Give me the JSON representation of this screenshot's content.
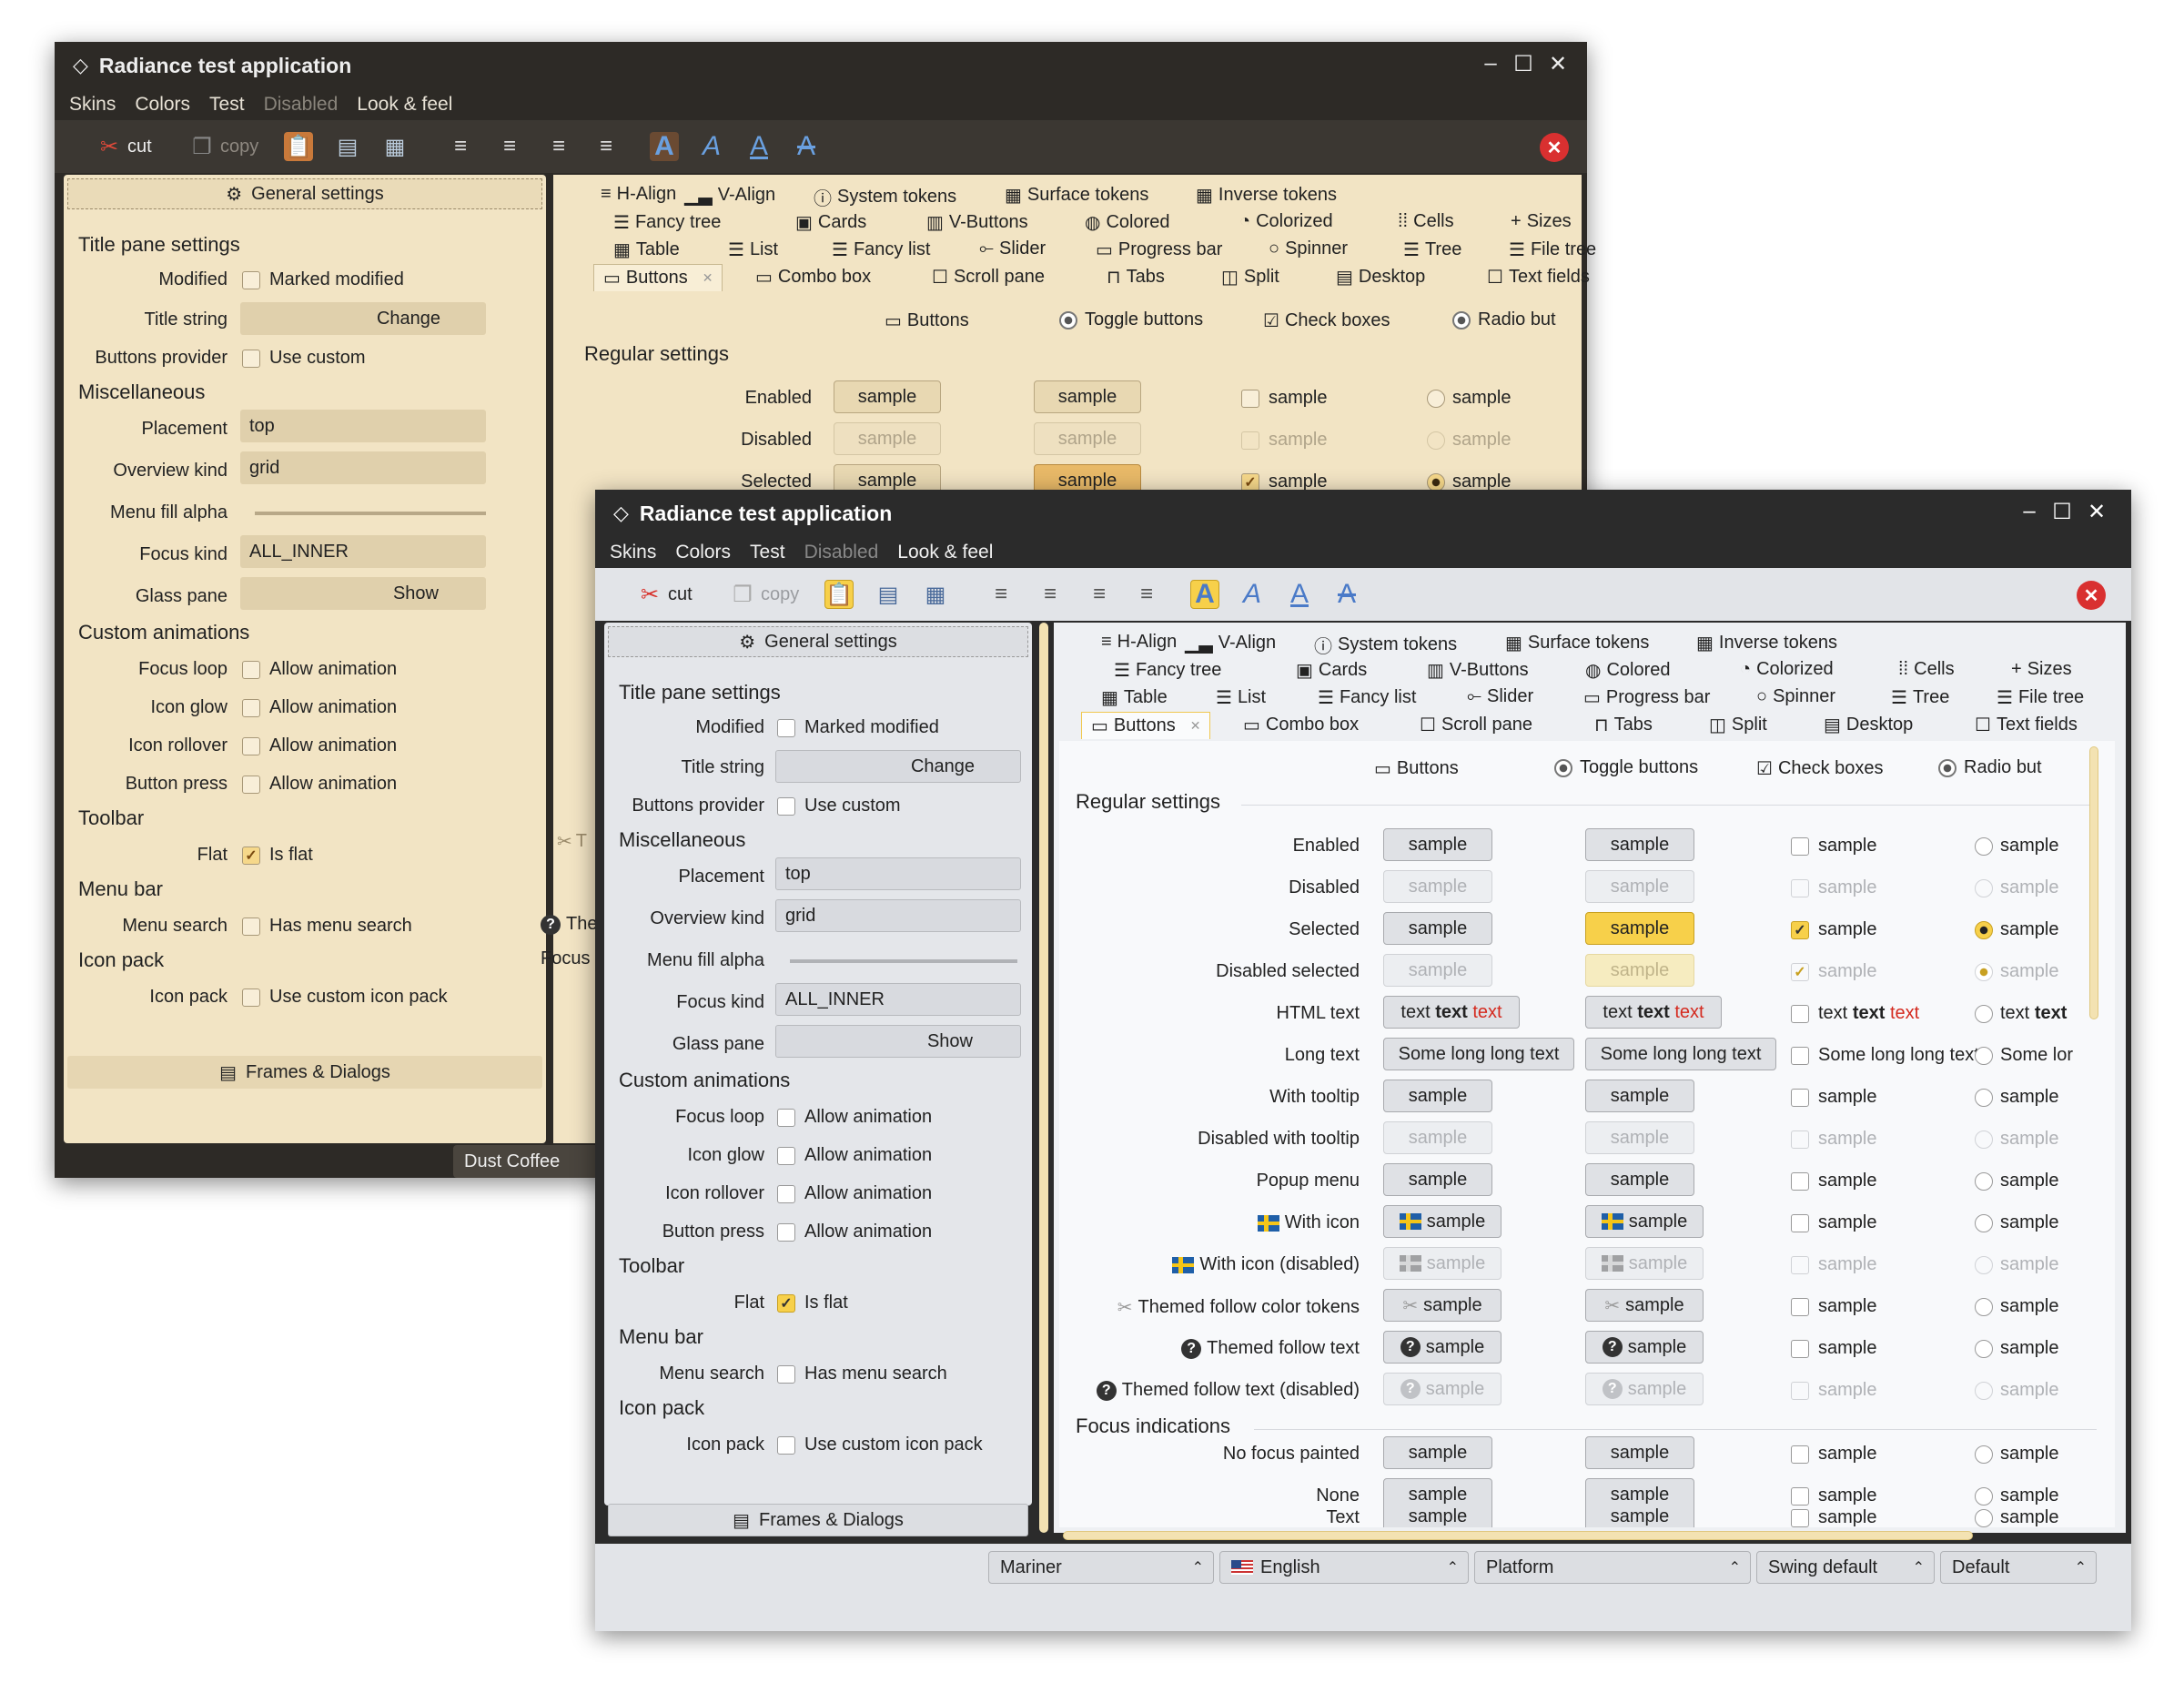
{
  "app": {
    "title": "Radiance test application"
  },
  "menu": [
    "Skins",
    "Colors",
    "Test",
    "Disabled",
    "Look & feel"
  ],
  "toolbar": {
    "cut": "cut",
    "copy": "copy"
  },
  "tabs_rows": [
    [
      "H-Align",
      "V-Align",
      "System tokens",
      "Surface tokens",
      "Inverse tokens"
    ],
    [
      "Fancy tree",
      "Cards",
      "V-Buttons",
      "Colored",
      "Colorized",
      "Cells",
      "Sizes"
    ],
    [
      "Table",
      "List",
      "Fancy list",
      "Slider",
      "Progress bar",
      "Spinner",
      "Tree",
      "File tree"
    ],
    [
      "Buttons",
      "Combo box",
      "Scroll pane",
      "Tabs",
      "Split",
      "Desktop",
      "Text fields"
    ]
  ],
  "left": {
    "general": "General settings",
    "title_pane": "Title pane settings",
    "modified_lbl": "Modified",
    "modified_cb": "Marked modified",
    "title_string_lbl": "Title string",
    "change": "Change",
    "buttons_provider_lbl": "Buttons provider",
    "use_custom": "Use custom",
    "misc": "Miscellaneous",
    "placement_lbl": "Placement",
    "placement_val": "top",
    "overview_lbl": "Overview kind",
    "overview_val": "grid",
    "menu_fill_lbl": "Menu fill alpha",
    "menu_fill_value": 1.0,
    "focus_kind_lbl": "Focus kind",
    "focus_kind_val": "ALL_INNER",
    "glass_lbl": "Glass pane",
    "show": "Show",
    "custom_anim": "Custom animations",
    "focus_loop": "Focus loop",
    "icon_glow": "Icon glow",
    "icon_rollover": "Icon rollover",
    "button_press": "Button press",
    "allow_anim": "Allow animation",
    "toolbar_sec": "Toolbar",
    "flat_lbl": "Flat",
    "is_flat": "Is flat",
    "menubar_sec": "Menu bar",
    "menu_search_lbl": "Menu search",
    "has_menu_search": "Has menu search",
    "iconpack_sec": "Icon pack",
    "iconpack_lbl": "Icon pack",
    "use_custom_iconpack": "Use custom icon pack",
    "frames": "Frames & Dialogs"
  },
  "buttons_panel": {
    "headers": [
      "Buttons",
      "Toggle buttons",
      "Check boxes",
      "Radio but"
    ],
    "regular": "Regular settings",
    "focus": "Focus indications",
    "sample": "sample"
  },
  "back": {
    "skin": "Dust Coffee",
    "partial_q": "The",
    "partial_focus": "Focus",
    "partial_t": "T"
  },
  "rows": [
    {
      "label": "Enabled",
      "b1": "sample",
      "b2": "sample",
      "c": "sample",
      "r": "sample"
    },
    {
      "label": "Disabled",
      "b1": "sample",
      "b2": "sample",
      "c": "sample",
      "r": "sample"
    },
    {
      "label": "Selected",
      "b1": "sample",
      "b2": "sample",
      "c": "sample",
      "r": "sample"
    },
    {
      "label": "Disabled selected",
      "b1": "sample",
      "b2": "sample",
      "c": "sample",
      "r": "sample"
    },
    {
      "label": "HTML text",
      "t1": "text",
      "t2": "text",
      "t3": "text",
      "r": "text text"
    },
    {
      "label": "Long text",
      "b1": "Some long long text",
      "b2": "Some long long text",
      "c": "Some long long text",
      "r": "Some lor"
    },
    {
      "label": "With tooltip",
      "b1": "sample",
      "b2": "sample",
      "c": "sample",
      "r": "sample"
    },
    {
      "label": "Disabled with tooltip",
      "b1": "sample",
      "b2": "sample",
      "c": "sample",
      "r": "sample"
    },
    {
      "label": "Popup menu",
      "b1": "sample",
      "b2": "sample",
      "c": "sample",
      "r": "sample"
    },
    {
      "label": "With icon",
      "b1": "sample",
      "b2": "sample",
      "c": "sample",
      "r": "sample"
    },
    {
      "label": "With icon (disabled)",
      "b1": "sample",
      "b2": "sample",
      "c": "sample",
      "r": "sample"
    },
    {
      "label": "Themed follow color tokens",
      "b1": "sample",
      "b2": "sample",
      "c": "sample",
      "r": "sample"
    },
    {
      "label": "Themed follow text",
      "b1": "sample",
      "b2": "sample",
      "c": "sample",
      "r": "sample"
    },
    {
      "label": "Themed follow text (disabled)",
      "b1": "sample",
      "b2": "sample",
      "c": "sample",
      "r": "sample"
    }
  ],
  "focus_rows": [
    {
      "label": "No focus painted",
      "b1": "sample",
      "b2": "sample",
      "c": "sample",
      "r": "sample"
    },
    {
      "label": "None",
      "b1": "sample",
      "b2": "sample",
      "c": "sample",
      "r": "sample"
    },
    {
      "label": "Text",
      "b1": "sample",
      "b2": "sample",
      "c": "sample",
      "r": "sample"
    }
  ],
  "statusbar": [
    "Mariner",
    "English",
    "Platform",
    "Swing default",
    "Default"
  ],
  "colors": {
    "back_accent": "#f2e4c4",
    "front_accent": "#f7d04a",
    "close": "#d93030"
  }
}
